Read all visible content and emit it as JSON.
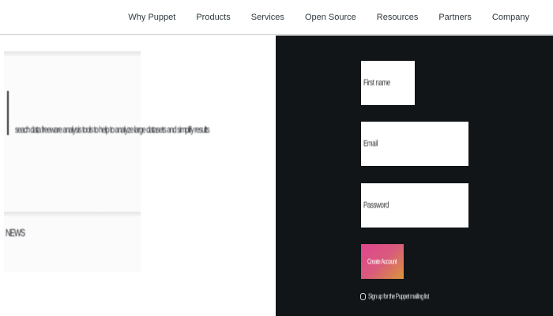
{
  "nav": {
    "items": [
      {
        "label": "Why Puppet"
      },
      {
        "label": "Products"
      },
      {
        "label": "Services"
      },
      {
        "label": "Open Source"
      },
      {
        "label": "Resources"
      },
      {
        "label": "Partners"
      },
      {
        "label": "Company"
      }
    ]
  },
  "left": {
    "headline": "seach data freeware analysis tools to help to analyze large datasets and simplify results",
    "footer": "NEWS"
  },
  "form": {
    "firstname_placeholder": "First name",
    "email_placeholder": "Email",
    "password_placeholder": "Password",
    "create_label": "Create Account",
    "signup_label": "Sign up for the Puppet mailing list"
  },
  "colors": {
    "dark_panel": "#121518",
    "button_gradient_start": "#e0458f",
    "button_gradient_end": "#d9963a"
  }
}
